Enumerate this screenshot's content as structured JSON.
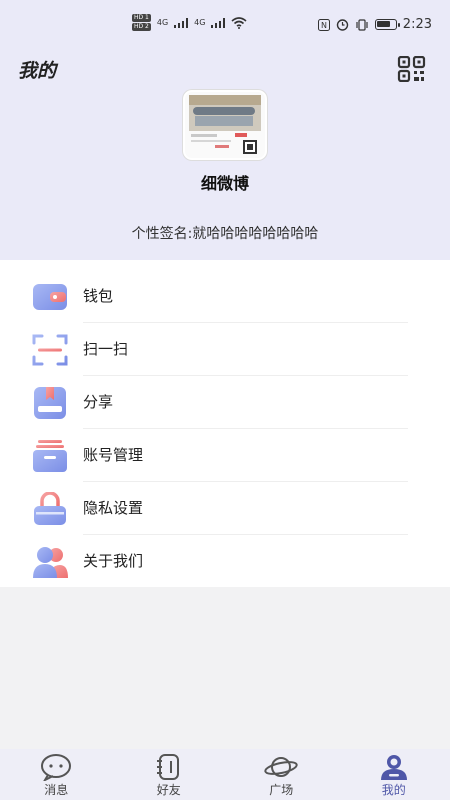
{
  "status_bar": {
    "network_left_1": "HD 1",
    "network_left_2": "HD 2",
    "signal1": "4G",
    "signal2": "4G",
    "time": "2:23"
  },
  "header": {
    "title": "我的",
    "qr_icon": "qr-code-icon"
  },
  "profile": {
    "nickname": "细微博",
    "signature": "个性签名:就哈哈哈哈哈哈哈哈"
  },
  "menu": {
    "items": [
      {
        "label": "钱包",
        "icon": "wallet-icon"
      },
      {
        "label": "扫一扫",
        "icon": "scan-icon"
      },
      {
        "label": "分享",
        "icon": "share-icon"
      },
      {
        "label": "账号管理",
        "icon": "account-manage-icon"
      },
      {
        "label": "隐私设置",
        "icon": "lock-icon"
      },
      {
        "label": "关于我们",
        "icon": "about-us-icon"
      }
    ]
  },
  "tab_bar": {
    "tabs": [
      {
        "label": "消息",
        "icon": "message-icon"
      },
      {
        "label": "好友",
        "icon": "friends-icon"
      },
      {
        "label": "广场",
        "icon": "planet-icon"
      },
      {
        "label": "我的",
        "icon": "profile-icon"
      }
    ],
    "active": "我的"
  },
  "colors": {
    "header_bg": "#eaeaf8",
    "accent": "#4f57a8",
    "icon_gradient_start": "#8fa8f0",
    "icon_gradient_end": "#f07a7a"
  }
}
